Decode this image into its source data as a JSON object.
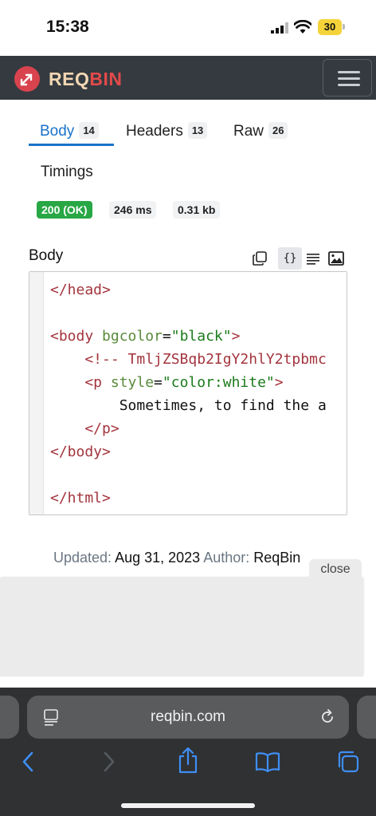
{
  "status_bar": {
    "time": "15:38",
    "battery": "30"
  },
  "navbar": {
    "logo_req": "REQ",
    "logo_bin": "BIN"
  },
  "tabs": [
    {
      "label": "Body",
      "count": "14",
      "active": true
    },
    {
      "label": "Headers",
      "count": "13",
      "active": false
    },
    {
      "label": "Raw",
      "count": "26",
      "active": false
    },
    {
      "label": "Timings",
      "count": "",
      "active": false
    }
  ],
  "response": {
    "status": "200 (OK)",
    "time": "246 ms",
    "size": "0.31 kb"
  },
  "body_section": {
    "title": "Body"
  },
  "code": {
    "l1": "</head>",
    "l2_tag_open": "<body ",
    "l2_attr": "bgcolor",
    "l2_eq": "=",
    "l2_val": "\"black\"",
    "l2_close": ">",
    "l3": "    <!-- TmljZSBqb2IgY2hlY2tpbmc",
    "l4_tag_open": "    <p ",
    "l4_attr": "style",
    "l4_eq": "=",
    "l4_val": "\"color:white\"",
    "l4_close": ">",
    "l5": "        Sometimes, to find the a",
    "l6": "    </p>",
    "l7": "</body>",
    "l8": "</html>"
  },
  "footer": {
    "updated_label": "Updated:",
    "updated_value": "Aug 31, 2023",
    "author_label": "Author:",
    "author_value": "ReqBin"
  },
  "popup": {
    "close_label": "close"
  },
  "browser": {
    "url": "reqbin.com"
  },
  "colors": {
    "accent": "#1a73c9",
    "success": "#28a745",
    "navbar": "#343a40",
    "brand_red": "#e34a4a"
  }
}
